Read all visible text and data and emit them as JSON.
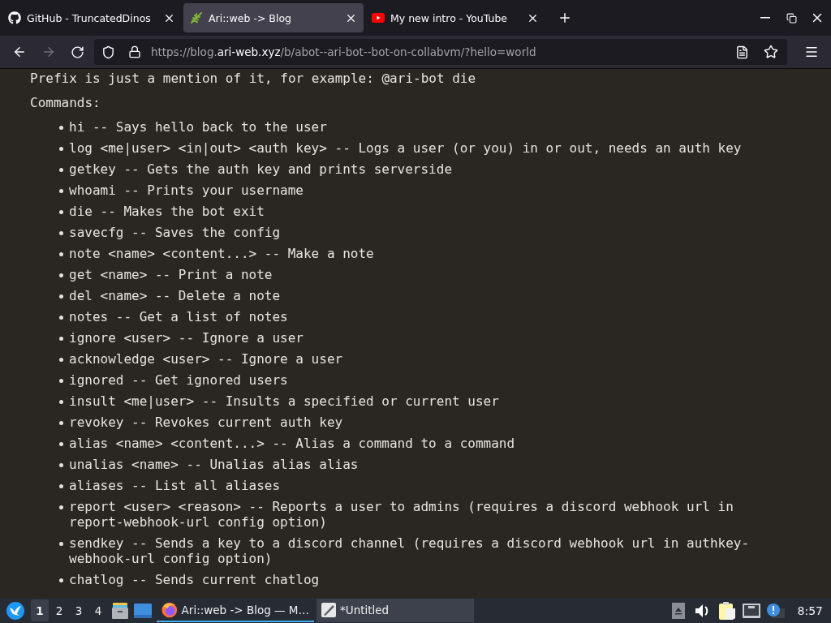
{
  "tabs": [
    {
      "title": "GitHub - TruncatedDinos",
      "selected": false
    },
    {
      "title": "Ari::web -> Blog",
      "selected": true
    },
    {
      "title": "My new intro - YouTube",
      "selected": false
    }
  ],
  "nav_buttons": [
    {
      "kind": "back",
      "disabled": false
    },
    {
      "kind": "forward",
      "disabled": true
    },
    {
      "kind": "reload",
      "disabled": false
    }
  ],
  "address": {
    "before_domain": "https://blog.",
    "domain": "ari-web.xyz",
    "after_domain": "/b/abot--ari-bot--bot-on-collabvm/?hello=world"
  },
  "page": {
    "intro": "Prefix is just a mention of it, for example: @ari-bot die",
    "heading": "Commands:",
    "commands": [
      "hi -- Says hello back to the user",
      "log <me|user> <in|out> <auth key> -- Logs a user (or you) in or out, needs an auth key",
      "getkey -- Gets the auth key and prints serverside",
      "whoami -- Prints your username",
      "die -- Makes the bot exit",
      "savecfg -- Saves the config",
      "note <name> <content...> -- Make a note",
      "get <name> -- Print a note",
      "del <name> -- Delete a note",
      "notes -- Get a list of notes",
      "ignore <user> -- Ignore a user",
      "acknowledge <user> -- Ignore a user",
      "ignored -- Get ignored users",
      "insult <me|user> -- Insults a specified or current user",
      "revokey -- Revokes current auth key",
      "alias <name> <content...> -- Alias a command to a command",
      "unalias <name> -- Unalias alias alias",
      "aliases -- List all aliases",
      "report <user> <reason> -- Reports a user to admins (requires a discord webhook url in report-webhook-url config option)",
      "sendkey -- Sends a key to a discord channel (requires a discord webhook url in authkey-webhook-url config option)",
      "chatlog -- Sends current chatlog"
    ]
  },
  "taskbar": {
    "workspaces": [
      {
        "label": "1",
        "selected": true
      },
      {
        "label": "2",
        "selected": false
      },
      {
        "label": "3",
        "selected": false
      },
      {
        "label": "4",
        "selected": false
      }
    ],
    "tasks": [
      {
        "title": "Ari::web -> Blog — M…",
        "selected": true
      },
      {
        "title": "*Untitled",
        "selected": false
      }
    ],
    "clock": "8:57"
  }
}
